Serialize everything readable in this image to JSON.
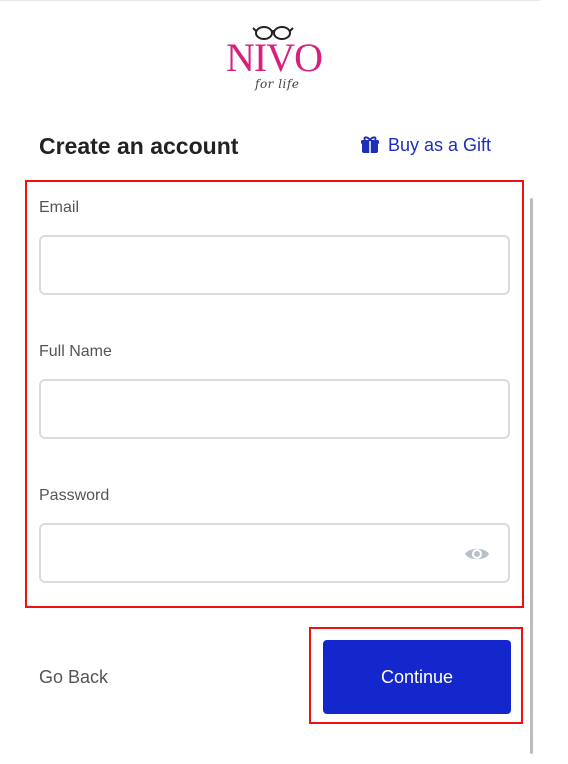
{
  "brand": {
    "logo_text": "NIVO",
    "logo_tagline": "for life",
    "primary_color": "#d6207e"
  },
  "header": {
    "title": "Create an account",
    "gift_label": "Buy as a Gift",
    "gift_icon": "gift-icon",
    "link_color": "#1e2fb7"
  },
  "form": {
    "email": {
      "label": "Email",
      "value": "",
      "placeholder": ""
    },
    "full_name": {
      "label": "Full Name",
      "value": "",
      "placeholder": ""
    },
    "password": {
      "label": "Password",
      "value": "",
      "placeholder": "",
      "toggle_icon": "eye-icon"
    }
  },
  "actions": {
    "back_label": "Go Back",
    "continue_label": "Continue",
    "continue_color": "#1327cc"
  },
  "highlight_color": "#ee1111"
}
